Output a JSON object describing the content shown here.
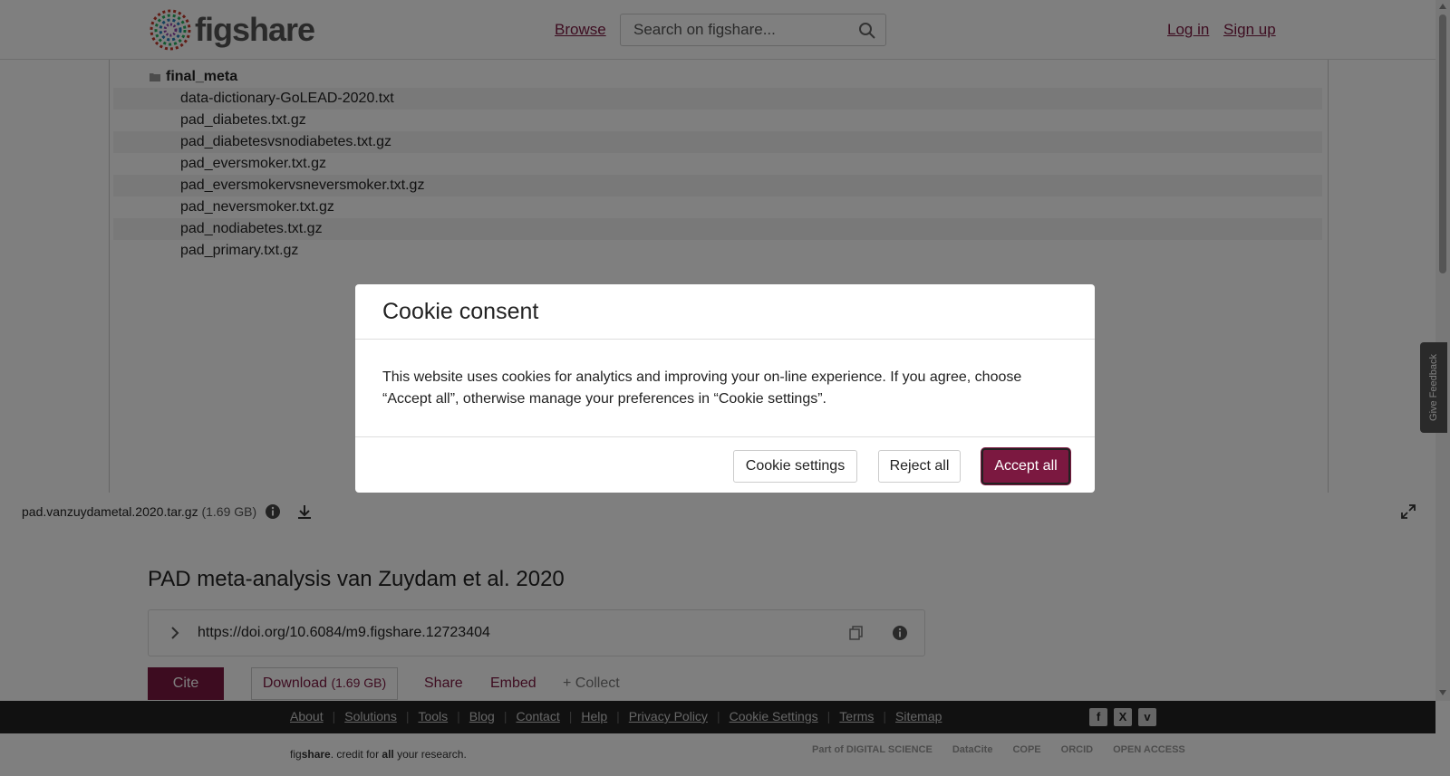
{
  "header": {
    "logo_text": "figshare",
    "browse": "Browse",
    "search_placeholder": "Search on figshare...",
    "login": "Log in",
    "signup": "Sign up"
  },
  "tree": {
    "folder": "final_meta",
    "files": [
      "data-dictionary-GoLEAD-2020.txt",
      "pad_diabetes.txt.gz",
      "pad_diabetesvsnodiabetes.txt.gz",
      "pad_eversmoker.txt.gz",
      "pad_eversmokervsneversmoker.txt.gz",
      "pad_neversmoker.txt.gz",
      "pad_nodiabetes.txt.gz",
      "pad_primary.txt.gz"
    ]
  },
  "file_bar": {
    "name": "pad.vanzuydametal.2020.tar.gz",
    "size": "(1.69 GB)"
  },
  "item": {
    "title": "PAD meta-analysis van Zuydam et al. 2020",
    "doi": "https://doi.org/10.6084/m9.figshare.12723404",
    "cite": "Cite",
    "download": "Download",
    "download_size": "(1.69 GB)",
    "share": "Share",
    "embed": "Embed",
    "collect": "+ Collect"
  },
  "footer": {
    "links": [
      "About",
      "Solutions",
      "Tools",
      "Blog",
      "Contact",
      "Help",
      "Privacy Policy",
      "Cookie Settings",
      "Terms",
      "Sitemap"
    ],
    "tagline_1": "fig",
    "tagline_2": "share",
    "tagline_3": ". credit for ",
    "tagline_4": "all",
    "tagline_5": " your research.",
    "partners": [
      "Part of DIGITAL SCIENCE",
      "DataCite",
      "COPE",
      "ORCID",
      "OPEN ACCESS"
    ]
  },
  "feedback": "Give Feedback",
  "modal": {
    "title": "Cookie consent",
    "body": "This website uses cookies for analytics and improving your on-line experience. If you agree, choose “Accept all”, otherwise manage your preferences in “Cookie settings”.",
    "settings": "Cookie settings",
    "reject": "Reject all",
    "accept": "Accept all"
  },
  "colors": {
    "brand": "#7b1840",
    "footer_bg": "#222222",
    "overlay": "rgba(0,0,0,0.5)"
  }
}
